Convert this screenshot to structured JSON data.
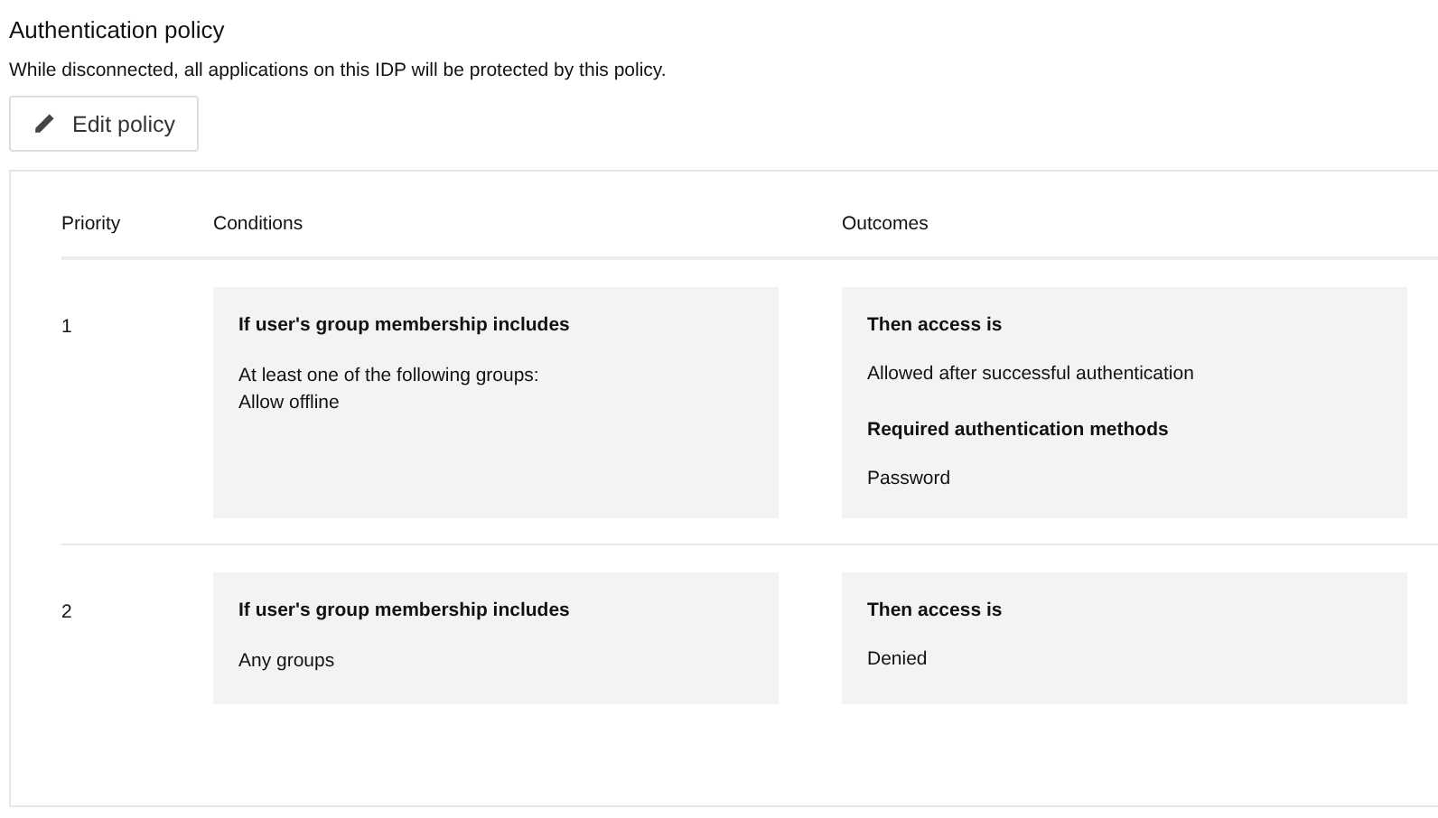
{
  "title": "Authentication policy",
  "description": "While disconnected, all applications on this IDP will be protected by this policy.",
  "edit_button": {
    "label": "Edit policy"
  },
  "table": {
    "columns": [
      "Priority",
      "Conditions",
      "Outcomes"
    ],
    "rows": [
      {
        "priority": "1",
        "condition": {
          "heading": "If user's group membership includes",
          "lines": [
            "At least one of the following groups:",
            "Allow offline"
          ]
        },
        "outcomes": [
          {
            "heading": "Then access is",
            "value": "Allowed after successful authentication"
          },
          {
            "heading": "Required authentication methods",
            "value": "Password"
          }
        ]
      },
      {
        "priority": "2",
        "condition": {
          "heading": "If user's group membership includes",
          "lines": [
            "Any groups"
          ]
        },
        "outcomes": [
          {
            "heading": "Then access is",
            "value": "Denied"
          }
        ]
      }
    ]
  }
}
